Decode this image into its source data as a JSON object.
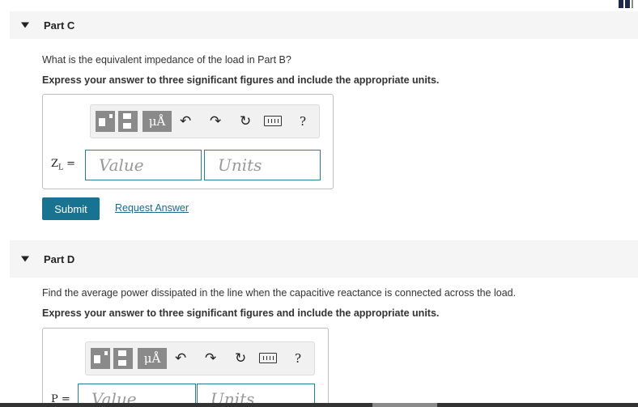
{
  "partC": {
    "title": "Part C",
    "question": "What is the equivalent impedance of the load in Part B?",
    "instruction": "Express your answer to three significant figures and include the appropriate units.",
    "var_label": "Z",
    "var_sub": "L",
    "eq": " =",
    "value_placeholder": "Value",
    "units_placeholder": "Units",
    "submit_label": "Submit",
    "request_label": "Request Answer"
  },
  "partD": {
    "title": "Part D",
    "question": "Find the average power dissipated in the line when the capacitive reactance is connected across the load.",
    "instruction": "Express your answer to three significant figures and include the appropriate units.",
    "var_label": "P =",
    "value_placeholder": "Value",
    "units_placeholder": "Units"
  },
  "toolbar": {
    "units_glyph": "μÅ",
    "undo_glyph": "↶",
    "redo_glyph": "↷",
    "reset_glyph": "↻",
    "help_glyph": "?"
  },
  "icons": [
    "templates-icon",
    "units-icon",
    "undo-icon",
    "redo-icon",
    "reset-icon",
    "keyboard-icon",
    "help-icon"
  ]
}
